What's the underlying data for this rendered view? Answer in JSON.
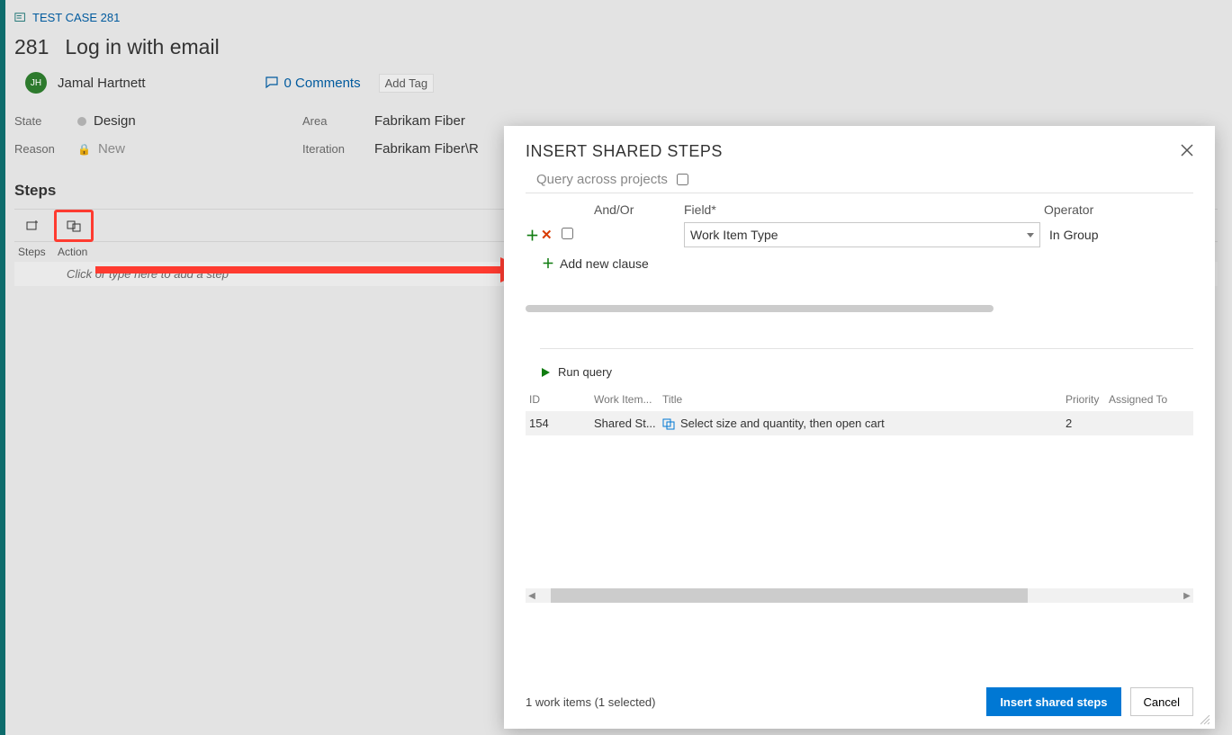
{
  "breadcrumb": {
    "label": "TEST CASE 281"
  },
  "workitem": {
    "id": "281",
    "title": "Log in with email",
    "owner_initials": "JH",
    "owner_name": "Jamal Hartnett",
    "comments_count": "0 Comments",
    "add_tag": "Add Tag",
    "state_label": "State",
    "state_value": "Design",
    "reason_label": "Reason",
    "reason_value": "New",
    "area_label": "Area",
    "area_value": "Fabrikam Fiber",
    "iteration_label": "Iteration",
    "iteration_value": "Fabrikam Fiber\\R"
  },
  "steps": {
    "heading": "Steps",
    "col_steps": "Steps",
    "col_action": "Action",
    "placeholder": "Click or type here to add a step"
  },
  "dialog": {
    "title": "INSERT SHARED STEPS",
    "query_across": "Query across projects",
    "head_andor": "And/Or",
    "head_field": "Field*",
    "head_operator": "Operator",
    "row_field": "Work Item Type",
    "row_op": "In Group",
    "add_clause": "Add new clause",
    "run_query": "Run query",
    "res": {
      "id_h": "ID",
      "type_h": "Work Item...",
      "title_h": "Title",
      "priority_h": "Priority",
      "assigned_h": "Assigned To",
      "id": "154",
      "type": "Shared St...",
      "title": "Select size and quantity, then open cart",
      "priority": "2",
      "assigned": ""
    },
    "status": "1 work items (1 selected)",
    "insert_btn": "Insert shared steps",
    "cancel_btn": "Cancel"
  }
}
